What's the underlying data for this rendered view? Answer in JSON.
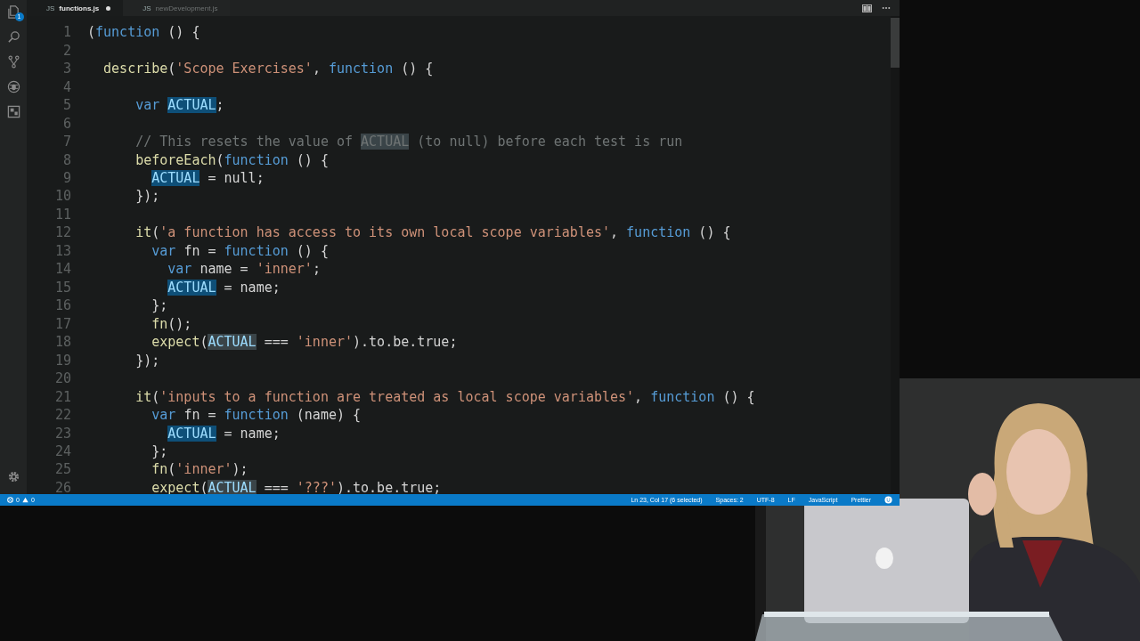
{
  "tabs": [
    {
      "icon_label": "JS",
      "label": "functions.js",
      "selected": true,
      "modified": true
    },
    {
      "icon_label": "JS",
      "label": "newDevelopment.js",
      "selected": false,
      "modified": false
    }
  ],
  "activity_bar": {
    "items": [
      {
        "kind": "files",
        "badge": "1"
      },
      {
        "kind": "search"
      },
      {
        "kind": "source-control"
      },
      {
        "kind": "debug"
      },
      {
        "kind": "extensions"
      }
    ]
  },
  "lines": [
    {
      "number": "1",
      "tokens": [
        {
          "kind": "plain",
          "text": "("
        },
        {
          "kind": "keyword",
          "text": "function"
        },
        {
          "kind": "plain",
          "text": " () {"
        }
      ]
    },
    {
      "number": "2"
    },
    {
      "number": "3",
      "tokens": [
        {
          "kind": "call",
          "text": "  describe"
        },
        {
          "kind": "plain",
          "text": "("
        },
        {
          "kind": "string",
          "text": "'Scope Exercises'"
        },
        {
          "kind": "plain",
          "text": ", "
        },
        {
          "kind": "keyword",
          "text": "function"
        },
        {
          "kind": "plain",
          "text": " () {"
        }
      ]
    },
    {
      "number": "4"
    },
    {
      "number": "5",
      "tokens": [
        {
          "kind": "keyword",
          "text": "      var "
        },
        {
          "kind": "selection",
          "text": "ACTUAL"
        },
        {
          "kind": "plain",
          "text": ";"
        }
      ]
    },
    {
      "number": "6"
    },
    {
      "number": "7",
      "tokens": [
        {
          "kind": "comment",
          "text": "      // This resets the value of "
        },
        {
          "kind": "comment-match",
          "text": "ACTUAL"
        },
        {
          "kind": "comment",
          "text": " (to null) before each test is run"
        }
      ]
    },
    {
      "number": "8",
      "tokens": [
        {
          "kind": "call",
          "text": "      beforeEach"
        },
        {
          "kind": "plain",
          "text": "("
        },
        {
          "kind": "keyword",
          "text": "function"
        },
        {
          "kind": "plain",
          "text": " () {"
        }
      ]
    },
    {
      "number": "9",
      "tokens": [
        {
          "kind": "selection",
          "text": "        ACTUAL"
        },
        {
          "kind": "plain",
          "text": " = null;"
        }
      ]
    },
    {
      "number": "10",
      "tokens": [
        {
          "kind": "plain",
          "text": "      });"
        }
      ]
    },
    {
      "number": "11"
    },
    {
      "number": "12",
      "tokens": [
        {
          "kind": "call",
          "text": "      it"
        },
        {
          "kind": "plain",
          "text": "("
        },
        {
          "kind": "string",
          "text": "'a function has access to its own local scope variables'"
        },
        {
          "kind": "plain",
          "text": ", "
        },
        {
          "kind": "keyword",
          "text": "function"
        },
        {
          "kind": "plain",
          "text": " () {"
        }
      ]
    },
    {
      "number": "13",
      "tokens": [
        {
          "kind": "keyword",
          "text": "        var"
        },
        {
          "kind": "plain",
          "text": " fn = "
        },
        {
          "kind": "keyword",
          "text": "function"
        },
        {
          "kind": "plain",
          "text": " () {"
        }
      ]
    },
    {
      "number": "14",
      "tokens": [
        {
          "kind": "keyword",
          "text": "          var"
        },
        {
          "kind": "plain",
          "text": " name = "
        },
        {
          "kind": "string",
          "text": "'inner'"
        },
        {
          "kind": "plain",
          "text": ";"
        }
      ]
    },
    {
      "number": "15",
      "tokens": [
        {
          "kind": "selection",
          "text": "          ACTUAL"
        },
        {
          "kind": "plain",
          "text": " = name;"
        }
      ]
    },
    {
      "number": "16",
      "tokens": [
        {
          "kind": "plain",
          "text": "        };"
        }
      ]
    },
    {
      "number": "17",
      "tokens": [
        {
          "kind": "call",
          "text": "        fn"
        },
        {
          "kind": "plain",
          "text": "();"
        }
      ]
    },
    {
      "number": "18",
      "tokens": [
        {
          "kind": "call",
          "text": "        expect"
        },
        {
          "kind": "plain",
          "text": "("
        },
        {
          "kind": "match",
          "text": "ACTUAL"
        },
        {
          "kind": "plain",
          "text": " === "
        },
        {
          "kind": "string",
          "text": "'inner'"
        },
        {
          "kind": "plain",
          "text": ").to.be.true;"
        }
      ]
    },
    {
      "number": "19",
      "tokens": [
        {
          "kind": "plain",
          "text": "      });"
        }
      ]
    },
    {
      "number": "20"
    },
    {
      "number": "21",
      "tokens": [
        {
          "kind": "call",
          "text": "      it"
        },
        {
          "kind": "plain",
          "text": "("
        },
        {
          "kind": "string",
          "text": "'inputs to a function are treated as local scope variables'"
        },
        {
          "kind": "plain",
          "text": ", "
        },
        {
          "kind": "keyword",
          "text": "function"
        },
        {
          "kind": "plain",
          "text": " () {"
        }
      ]
    },
    {
      "number": "22",
      "tokens": [
        {
          "kind": "keyword",
          "text": "        var"
        },
        {
          "kind": "plain",
          "text": " fn = "
        },
        {
          "kind": "keyword",
          "text": "function"
        },
        {
          "kind": "plain",
          "text": " (name) {"
        }
      ]
    },
    {
      "number": "23",
      "tokens": [
        {
          "kind": "selection",
          "text": "          ACTUAL"
        },
        {
          "kind": "plain",
          "text": " = name;"
        }
      ]
    },
    {
      "number": "24",
      "tokens": [
        {
          "kind": "plain",
          "text": "        };"
        }
      ]
    },
    {
      "number": "25",
      "tokens": [
        {
          "kind": "call",
          "text": "        fn"
        },
        {
          "kind": "plain",
          "text": "("
        },
        {
          "kind": "string",
          "text": "'inner'"
        },
        {
          "kind": "plain",
          "text": ");"
        }
      ]
    },
    {
      "number": "26",
      "tokens": [
        {
          "kind": "call",
          "text": "        expect"
        },
        {
          "kind": "plain",
          "text": "("
        },
        {
          "kind": "match",
          "text": "ACTUAL"
        },
        {
          "kind": "plain",
          "text": " === "
        },
        {
          "kind": "string",
          "text": "'???'"
        },
        {
          "kind": "plain",
          "text": ").to.be.true;"
        }
      ]
    }
  ],
  "status_bar": {
    "errors": "0",
    "warnings": "0",
    "items": [
      "Ln 23, Col 17 (6 selected)",
      "Spaces: 2",
      "UTF-8",
      "LF",
      "JavaScript",
      "Prettier"
    ]
  }
}
